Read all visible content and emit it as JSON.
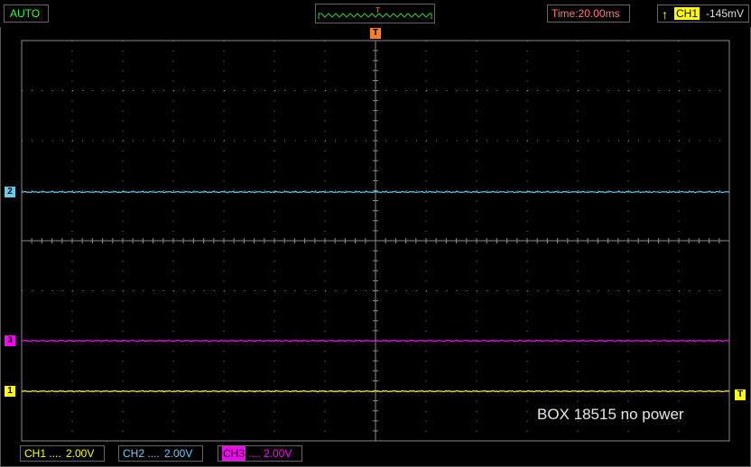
{
  "header": {
    "mode": "AUTO",
    "trigger_marker": "T",
    "time_label": "Time:20.00ms",
    "trigger_channel": "CH1",
    "trigger_level": "-145mV"
  },
  "markers": {
    "top_trigger": "T",
    "ch2": "2",
    "ch3": "3",
    "ch1": "1",
    "right_trigger": "T"
  },
  "channels": [
    {
      "name": "CH1",
      "coupling": "....",
      "scale": "2.00V",
      "color": "#ffff00"
    },
    {
      "name": "CH2",
      "coupling": "....",
      "scale": "2.00V",
      "color": "#66ccee"
    },
    {
      "name": "CH3",
      "coupling": "....",
      "scale": "2.00V",
      "color": "#ff00ff"
    }
  ],
  "annotation": "BOX  18515 no power",
  "colors": {
    "grid": "#8a8a8a",
    "ch1": "#ffff00",
    "ch2": "#66ccee",
    "ch3": "#ff00ff",
    "trigger_marker": "#ff7f27",
    "mode_text": "#33ff33",
    "time_text": "#ff7777"
  }
}
